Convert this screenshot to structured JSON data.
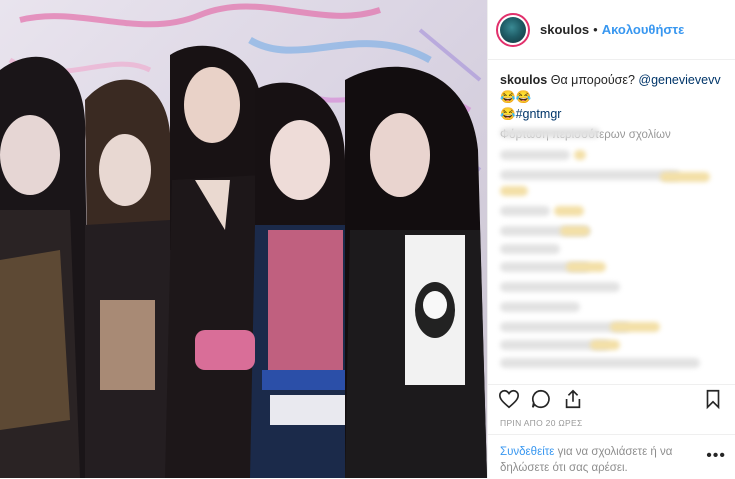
{
  "post": {
    "username": "skoulos",
    "dot": "•",
    "follow_label": "Ακολουθήστε",
    "caption_user": "skoulos",
    "caption_text": "Θα μπορούσε?",
    "caption_mention": "@genevievevv",
    "caption_emoji": "😂😂",
    "caption_emoji2": "😂",
    "caption_tag": "#gntmgr",
    "load_more": "Φόρτωση περισσότερων σχολίων",
    "time": "ΠΡΙΝ ΑΠΟ 20 ΩΡΕΣ",
    "login_link": "Συνδεθείτε",
    "login_text": "για να σχολιάσετε ή να δηλώσετε ότι σας αρέσει.",
    "more_options": "•••"
  },
  "icons": {
    "like": "heart-icon",
    "comment": "comment-icon",
    "share": "share-icon",
    "save": "bookmark-icon"
  },
  "colors": {
    "link": "#3897f0",
    "text": "#262626",
    "muted": "#999999"
  }
}
